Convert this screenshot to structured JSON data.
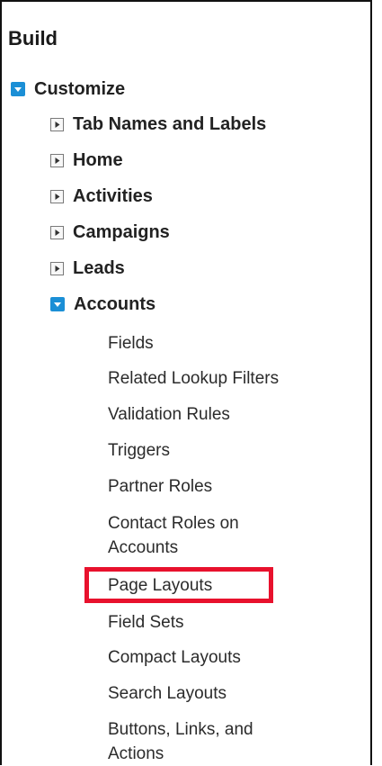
{
  "section": {
    "title": "Build"
  },
  "tree": {
    "customize": {
      "label": "Customize",
      "toggle": "expanded"
    },
    "items": [
      {
        "label": "Tab Names and Labels",
        "toggle": "collapsed"
      },
      {
        "label": "Home",
        "toggle": "collapsed"
      },
      {
        "label": "Activities",
        "toggle": "collapsed"
      },
      {
        "label": "Campaigns",
        "toggle": "collapsed"
      },
      {
        "label": "Leads",
        "toggle": "collapsed"
      }
    ],
    "accounts": {
      "label": "Accounts",
      "toggle": "expanded",
      "children": [
        "Fields",
        "Related Lookup Filters",
        "Validation Rules",
        "Triggers",
        "Partner Roles",
        "Contact Roles on Accounts",
        "Page Layouts",
        "Field Sets",
        "Compact Layouts",
        "Search Layouts",
        "Buttons, Links, and Actions"
      ]
    }
  },
  "colors": {
    "expanded_toggle": "#1b8fd6",
    "highlight_border": "#e8112d"
  },
  "icons": {
    "expanded": "caret-down-icon",
    "collapsed": "caret-right-icon"
  }
}
